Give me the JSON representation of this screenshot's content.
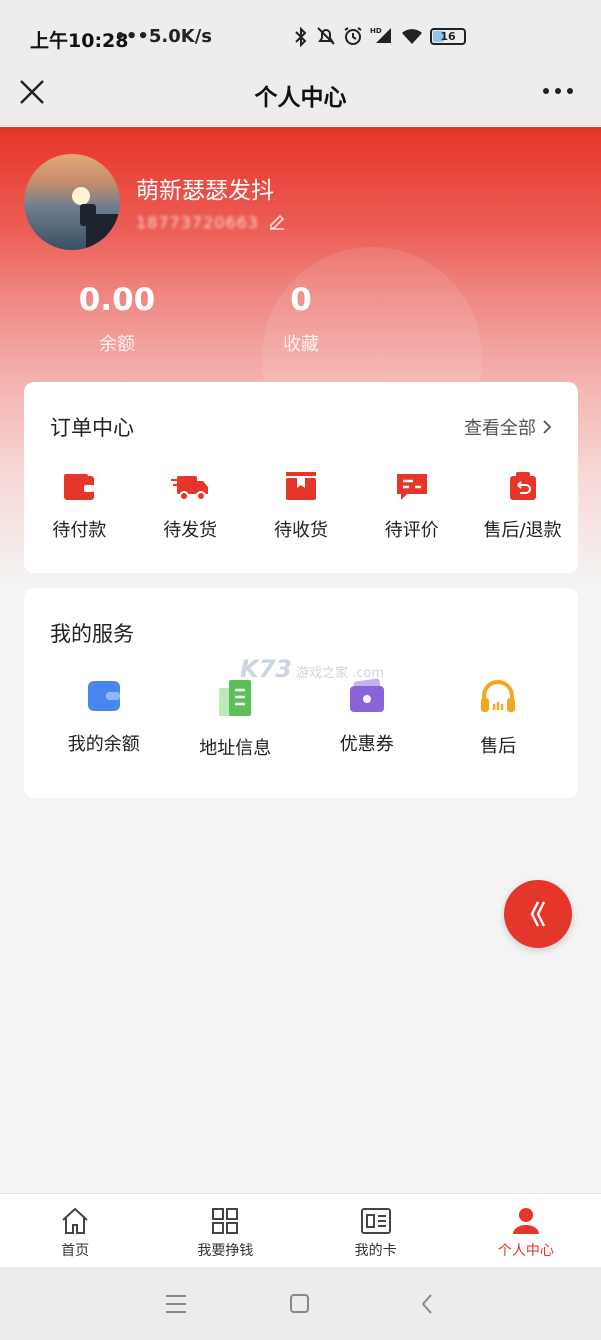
{
  "status_bar": {
    "time": "上午10:28",
    "speed": "•••5.0K/s",
    "battery": "16"
  },
  "nav": {
    "title": "个人中心"
  },
  "profile": {
    "name": "萌新瑟瑟发抖",
    "phone": "18773720663"
  },
  "stats": [
    {
      "value": "0.00",
      "label": "余额"
    },
    {
      "value": "0",
      "label": "收藏"
    }
  ],
  "orders": {
    "title": "订单中心",
    "view_all": "查看全部",
    "items": [
      {
        "label": "待付款",
        "icon": "wallet-icon"
      },
      {
        "label": "待发货",
        "icon": "truck-icon"
      },
      {
        "label": "待收货",
        "icon": "package-icon"
      },
      {
        "label": "待评价",
        "icon": "comment-icon"
      },
      {
        "label": "售后/退款",
        "icon": "refund-icon"
      }
    ]
  },
  "services": {
    "title": "我的服务",
    "items": [
      {
        "label": "我的余额",
        "icon": "wallet-icon"
      },
      {
        "label": "地址信息",
        "icon": "building-icon"
      },
      {
        "label": "优惠券",
        "icon": "ticket-icon"
      },
      {
        "label": "售后",
        "icon": "headset-icon"
      }
    ]
  },
  "watermark": {
    "main": "K73",
    "sub": "游戏之家 .com"
  },
  "tabs": [
    {
      "label": "首页"
    },
    {
      "label": "我要挣钱"
    },
    {
      "label": "我的卡"
    },
    {
      "label": "个人中心"
    }
  ],
  "colors": {
    "primary": "#e5362b",
    "blue": "#4a86ef",
    "green": "#5cc05a",
    "purple": "#8b63d8",
    "orange": "#f5a623"
  }
}
